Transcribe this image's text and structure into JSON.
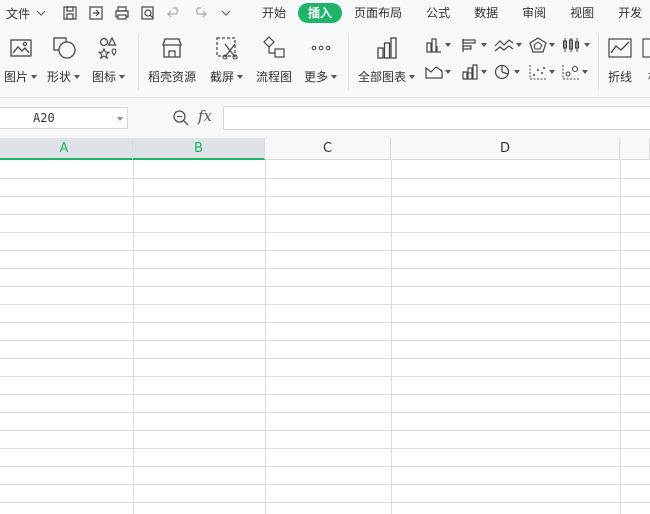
{
  "menubar": {
    "file_label": "文件",
    "tabs": [
      "开始",
      "插入",
      "页面布局",
      "公式",
      "数据",
      "审阅",
      "视图",
      "开发"
    ],
    "active_tab": "插入"
  },
  "ribbon": {
    "picture": "图片",
    "shape": "形状",
    "icon": "图标",
    "docer": "稻壳资源",
    "screenshot": "截屏",
    "flowchart": "流程图",
    "more": "更多",
    "all_charts": "全部图表",
    "line": "折线",
    "column": "柱"
  },
  "formula": {
    "cell_ref": "A20",
    "fx_label": "fx",
    "value": ""
  },
  "columns": [
    "A",
    "B",
    "C",
    "D"
  ],
  "colors": {
    "accent": "#1fb46a",
    "header_bg": "#f7f8fa",
    "selected_header_bg": "#dfe3e8",
    "grid_line": "#d8dbe0"
  }
}
